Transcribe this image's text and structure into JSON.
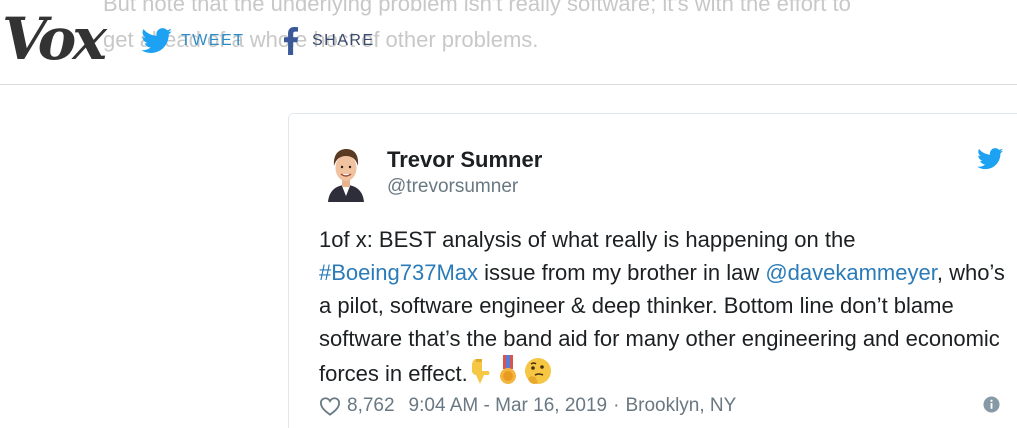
{
  "background_article": {
    "line1": "But note that the underlying problem isn't really software; it's with the effort to",
    "line2": "get ahead of a whole host of other problems."
  },
  "header": {
    "logo": "Vox",
    "tweet_label": "TWEET",
    "share_label": "SHARE"
  },
  "tweet": {
    "author_name": "Trevor Sumner",
    "author_handle": "@trevorsumner",
    "text_part1": "1of x: BEST analysis of what really is happening on the ",
    "hashtag": "#Boeing737Max",
    "text_part2": " issue from my brother in law ",
    "mention": "@davekammeyer",
    "text_part3": ", who’s a pilot, software engineer & deep thinker. Bottom line don’t blame software that’s the band aid for many other engineering and economic forces in effect.",
    "likes": "8,762",
    "time": "9:04 AM - Mar 16, 2019",
    "separator": "·",
    "location": "Brooklyn, NY"
  },
  "colors": {
    "twitter_blue": "#1da1f2",
    "link_blue": "#2b7bb9",
    "vox_gray": "#333333",
    "muted": "#697882"
  },
  "icons": [
    "twitter-bird-icon",
    "facebook-icon",
    "pointing-down-emoji",
    "medal-emoji",
    "thinking-face-emoji",
    "heart-icon",
    "info-icon"
  ]
}
